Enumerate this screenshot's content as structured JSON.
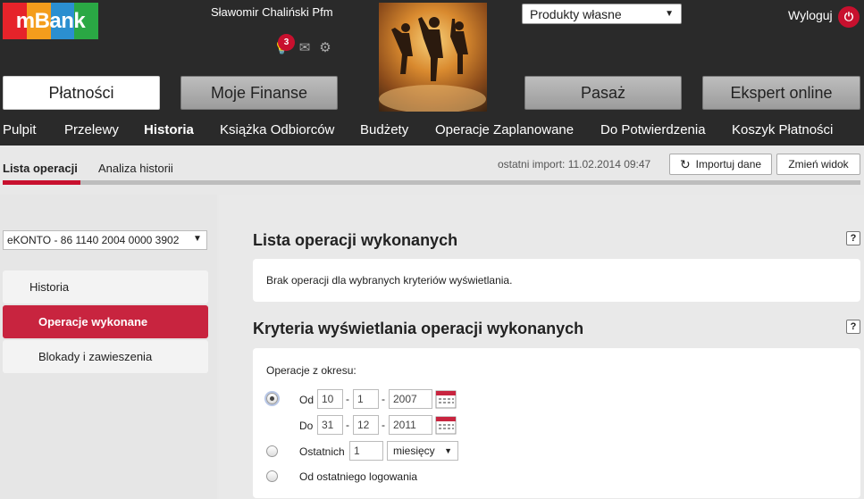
{
  "header": {
    "logo_text": "mBank",
    "logo_colors": [
      "#e6232a",
      "#f49d1c",
      "#2b8fd0",
      "#2aa844"
    ],
    "user_name": "Sławomir Chaliński Pfm",
    "notification_count": "3",
    "product_select": "Produkty własne",
    "logout_label": "Wyloguj"
  },
  "main_tabs": [
    {
      "label": "Płatności"
    },
    {
      "label": "Moje Finanse"
    },
    {
      "label": "Pasaż"
    },
    {
      "label": "Ekspert online"
    }
  ],
  "subnav": [
    {
      "label": "Pulpit"
    },
    {
      "label": "Przelewy"
    },
    {
      "label": "Historia"
    },
    {
      "label": "Książka Odbiorców"
    },
    {
      "label": "Budżety"
    },
    {
      "label": "Operacje Zaplanowane"
    },
    {
      "label": "Do Potwierdzenia"
    },
    {
      "label": "Koszyk Płatności"
    }
  ],
  "tabs2": [
    {
      "label": "Lista operacji"
    },
    {
      "label": "Analiza historii"
    }
  ],
  "import": {
    "last_import": "ostatni import: 11.02.2014 09:47",
    "import_button": "Importuj dane",
    "change_view_button": "Zmień widok"
  },
  "left": {
    "account": "eKONTO - 86 1140 2004 0000 3902",
    "menu": [
      {
        "label": "Historia"
      },
      {
        "label": "Operacje wykonane"
      },
      {
        "label": "Blokady i zawieszenia"
      }
    ]
  },
  "content": {
    "list_title": "Lista operacji wykonanych",
    "help_symbol": "?",
    "no_ops": "Brak operacji dla wybranych kryteriów wyświetlania.",
    "criteria_title": "Kryteria wyświetlania operacji wykonanych",
    "period_label": "Operacje z okresu:",
    "from_label": "Od",
    "to_label": "Do",
    "from": {
      "day": "10",
      "month": "1",
      "year": "2007"
    },
    "to": {
      "day": "31",
      "month": "12",
      "year": "2011"
    },
    "last_label": "Ostatnich",
    "last_value": "1",
    "unit": "miesięcy",
    "since_login": "Od ostatniego logowania"
  },
  "colors": {
    "accent": "#c8243f",
    "header": "#2a2a2a"
  }
}
